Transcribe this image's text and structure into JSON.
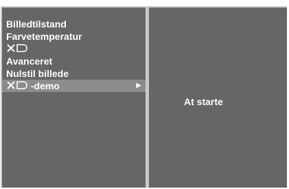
{
  "menu": {
    "items": [
      {
        "label": "Billedtilstand"
      },
      {
        "label": "Farvetemperatur"
      },
      {
        "label": ""
      },
      {
        "label": "Avanceret"
      },
      {
        "label": "Nulstil billede"
      },
      {
        "label": "-demo",
        "selected": true
      }
    ],
    "logo_text": "XD"
  },
  "right_panel": {
    "text": "At starte"
  }
}
